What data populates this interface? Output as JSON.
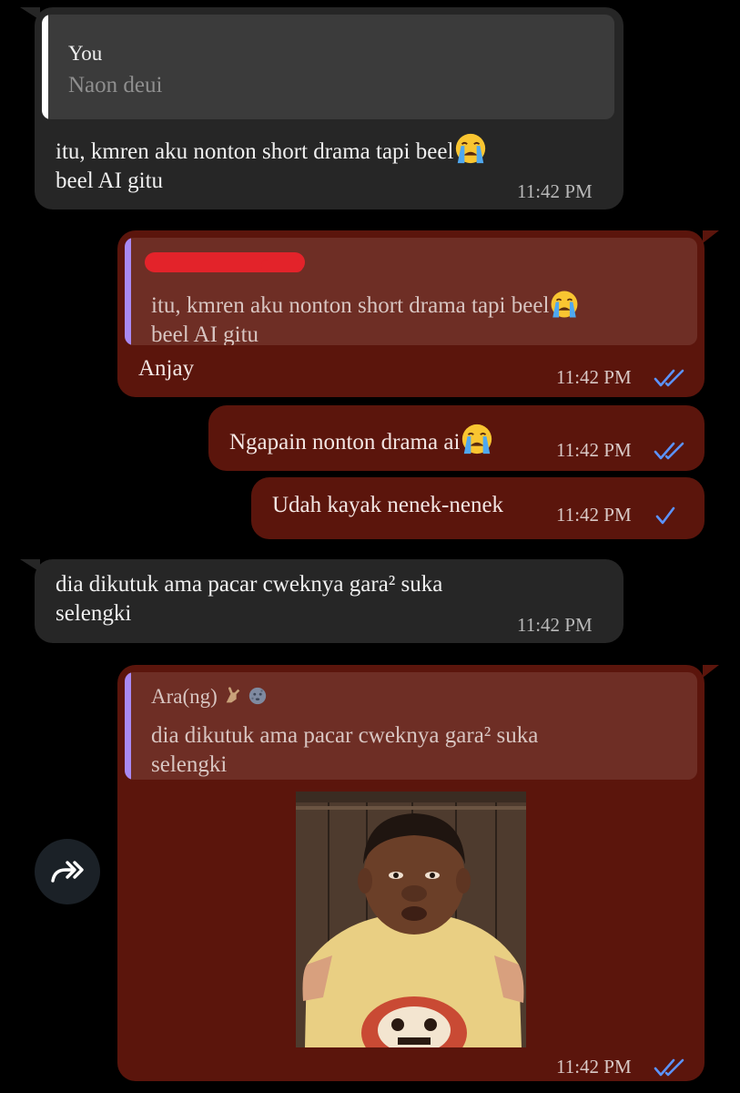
{
  "messages": {
    "m1": {
      "reply_sender": "You",
      "reply_text": "Naon deui",
      "text_line1": "itu, kmren aku nonton short drama tapi beel",
      "text_line2": "beel AI gitu",
      "emoji": "loudly-crying-face-icon",
      "time": "11:42 PM"
    },
    "m2": {
      "reply_line1": "itu, kmren aku nonton short drama tapi beel",
      "reply_line2": "beel AI gitu",
      "text": "Anjay",
      "time": "11:42 PM",
      "status": "read"
    },
    "m3": {
      "text": "Ngapain nonton drama ai",
      "emoji": "loudly-crying-face-icon",
      "time": "11:42 PM",
      "status": "read"
    },
    "m4": {
      "text": "Udah kayak nenek-nenek",
      "time": "11:42 PM",
      "status": "sent"
    },
    "m5": {
      "text_line1": "dia dikutuk ama pacar cweknya gara² suka",
      "text_line2": "selengki",
      "time": "11:42 PM"
    },
    "m6": {
      "reply_sender": "Ara(ng)",
      "reply_sender_icons": [
        "pointing-hand-icon",
        "new-moon-face-icon"
      ],
      "reply_line1": "dia dikutuk ama pacar cweknya gara² suka",
      "reply_line2": "selengki",
      "photo": "photo of a man in a yellow shirt sitting in front of a wooden wall",
      "time": "11:42 PM",
      "status": "read"
    }
  },
  "colors": {
    "background": "#000000",
    "incoming_bubble": "#262626",
    "outgoing_bubble": "#5b150c",
    "tick_blue": "#5b93ff",
    "reply_bar_in": "#ffffff",
    "reply_bar_out": "#a989f3"
  }
}
